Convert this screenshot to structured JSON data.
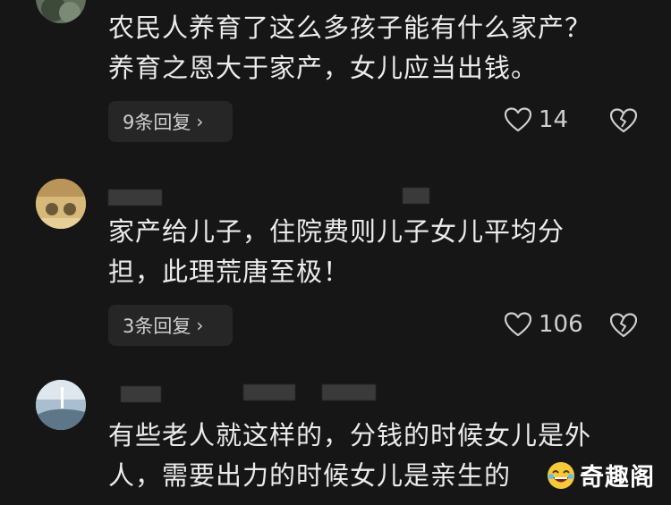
{
  "comments": [
    {
      "text_lines": [
        "农民人养育了这么多孩子能有什么家产？",
        "养育之恩大于家产，女儿应当出钱。"
      ],
      "replies_label": "9条回复",
      "likes": "14"
    },
    {
      "text_lines": [
        "家产给儿子，住院费则儿子女儿平均分",
        "担，此理荒唐至极！"
      ],
      "replies_label": "3条回复",
      "likes": "106"
    },
    {
      "text_lines": [
        "有些老人就这样的，分钱的时候女儿是外",
        "人，需要出力的时候女儿是亲生的"
      ]
    }
  ],
  "icons": {
    "chevron": "chevron-right-icon",
    "like": "heart-outline-icon",
    "dislike": "broken-heart-icon"
  },
  "watermark": {
    "text": "奇趣阁"
  },
  "colors": {
    "background": "#161616",
    "text": "#ececec",
    "reply_pill": "#262626",
    "muted": "#cfcfcf"
  }
}
